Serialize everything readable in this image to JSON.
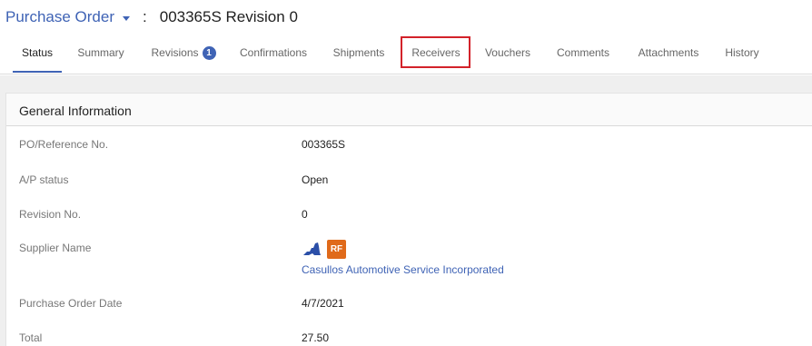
{
  "header": {
    "document_type": "Purchase Order",
    "separator": ":",
    "document_id": "003365S Revision 0"
  },
  "tabs": [
    {
      "label": "Status",
      "active": true
    },
    {
      "label": "Summary"
    },
    {
      "label": "Revisions",
      "badge": "1"
    },
    {
      "label": "Confirmations"
    },
    {
      "label": "Shipments"
    },
    {
      "label": "Receivers",
      "highlighted": true
    },
    {
      "label": "Vouchers"
    },
    {
      "label": "Comments"
    },
    {
      "label": "Attachments"
    },
    {
      "label": "History"
    }
  ],
  "panel": {
    "title": "General Information",
    "fields": {
      "po_ref": {
        "label": "PO/Reference No.",
        "value": "003365S"
      },
      "ap_status": {
        "label": "A/P status",
        "value": "Open"
      },
      "revision": {
        "label": "Revision No.",
        "value": "0"
      },
      "supplier": {
        "label": "Supplier Name",
        "badge_text": "RF",
        "name": "Casullos Automotive Service Incorporated"
      },
      "po_date": {
        "label": "Purchase Order Date",
        "value": "4/7/2021"
      },
      "total": {
        "label": "Total",
        "value": "27.50"
      }
    }
  },
  "colors": {
    "accent": "#3f63b5",
    "highlight": "#d3222a",
    "rf_badge": "#e06a1a"
  }
}
